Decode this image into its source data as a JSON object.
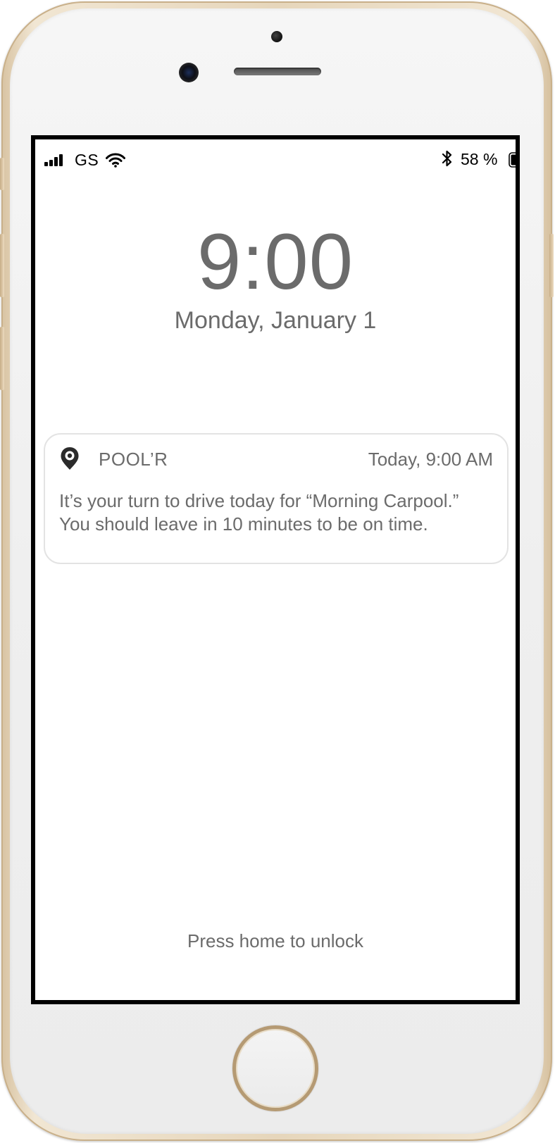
{
  "status_bar": {
    "carrier": "GS",
    "battery_percent": "58 %",
    "battery_level": 0.58,
    "signal_icon": "cellular-signal-icon",
    "wifi_icon": "wifi-icon",
    "bluetooth_icon": "bluetooth-icon",
    "battery_icon": "battery-icon"
  },
  "lock_screen": {
    "time": "9:00",
    "date": "Monday, January 1",
    "unlock_hint": "Press home to unlock"
  },
  "notification": {
    "app_icon": "location-pin-icon",
    "app_name": "POOL’R",
    "time": "Today, 9:00 AM",
    "body": "It’s your turn to drive today for “Morning Carpool.” You should leave in 10 minutes to be on time."
  },
  "colors": {
    "text_gray": "#6b6b6b",
    "screen_border": "#000000",
    "phone_frame_gold": "#e6d6bb",
    "home_ring_gold": "#b59a73"
  }
}
